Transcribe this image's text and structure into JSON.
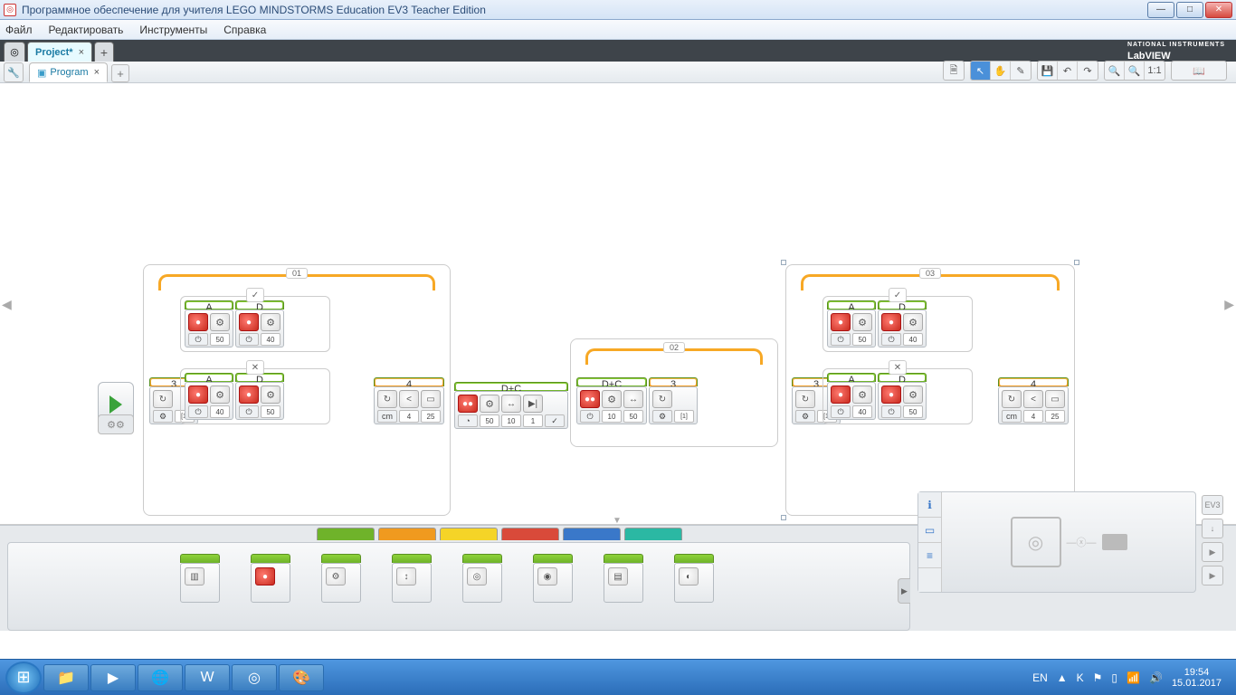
{
  "window": {
    "title": "Программное обеспечение для учителя LEGO MINDSTORMS Education EV3 Teacher Edition",
    "branding": "LabVIEW",
    "branding_sub": "NATIONAL INSTRUMENTS"
  },
  "menu": {
    "items": [
      "Файл",
      "Редактировать",
      "Инструменты",
      "Справка"
    ]
  },
  "project_tab": {
    "name": "Project*",
    "close": "×",
    "add": "+"
  },
  "program_tab": {
    "name": "Program",
    "close": "×",
    "add": "+"
  },
  "toolbar": {
    "doc": "🗎",
    "pointer": "↖",
    "hand": "✋",
    "comment": "✎",
    "save": "💾",
    "undo": "↶",
    "redo": "↷",
    "zoom_out": "🔍-",
    "zoom_in": "🔍+",
    "zoom_11": "1:1",
    "book": "📖"
  },
  "canvas": {
    "frame1": {
      "label": "01",
      "check": "✓",
      "cross": "✕"
    },
    "frame2": {
      "label": "02"
    },
    "frame3": {
      "label": "03",
      "check": "✓",
      "cross": "✕"
    },
    "ports": {
      "A": "A",
      "D": "D",
      "DC": "D+C",
      "num3": "3",
      "num4": "4",
      "bracket1": "[1]"
    },
    "vals": {
      "v50": "50",
      "v40": "40",
      "v25": "25",
      "v10": "10",
      "v1": "1",
      "v4": "4"
    },
    "icons": {
      "play": "▶",
      "loop": "↻",
      "loop_end": "↻",
      "compare": "<",
      "brick": "▭",
      "rotation": "⚙",
      "motor": "●",
      "power": "⏻",
      "steering": "↔",
      "timer": "◔",
      "cm": "cm",
      "stop": "■",
      "check": "✓"
    }
  },
  "palette": {
    "tabs": [
      "green",
      "orange",
      "yellow",
      "red",
      "blue",
      "teal"
    ],
    "blocks": [
      {
        "icon": "▥"
      },
      {
        "icon": "●"
      },
      {
        "icon": "⚙"
      },
      {
        "icon": "↕"
      },
      {
        "icon": "◎"
      },
      {
        "icon": "◉"
      },
      {
        "icon": "▤"
      },
      {
        "icon": "◐"
      }
    ]
  },
  "hardware": {
    "tabs": [
      "ℹ",
      "▭",
      "≡"
    ],
    "chain": [
      "◎",
      "—ⓧ—",
      "▬"
    ],
    "ev3": "EV3",
    "btns": [
      "↓",
      "▶",
      "●",
      "▶"
    ]
  },
  "taskbar": {
    "apps": [
      "📁",
      "▶",
      "🌐",
      "W",
      "◎",
      "🎨"
    ],
    "lang": "EN",
    "tray_icons": [
      "▲",
      "K",
      "⚑",
      "▯",
      "📶",
      "🔊"
    ],
    "time": "19:54",
    "date": "15.01.2017"
  }
}
